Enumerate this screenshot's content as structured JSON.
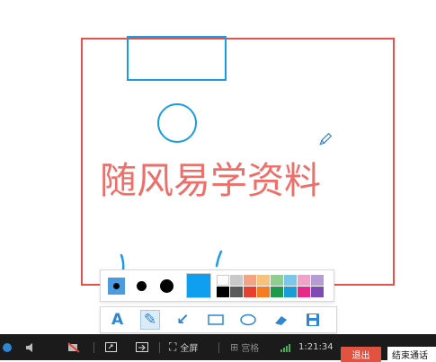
{
  "canvas": {
    "watermark_text": "随风易学资料"
  },
  "colors": {
    "stroke_red": "#e8504a",
    "stroke_blue": "#1a9be8",
    "current_color": "#0f9ff0",
    "toolbar_accent": "#4b9be0",
    "exit_button": "#e25241"
  },
  "toolbar": {
    "sizes": [
      "small-dot",
      "medium-dot",
      "large-dot"
    ],
    "selected_size": "small-dot",
    "palette": [
      "#ffffff",
      "#c9c9c9",
      "#f4a383",
      "#f8c27e",
      "#8fce90",
      "#7bc6ea",
      "#f0a3c8",
      "#b59dd4",
      "#000000",
      "#5a5a5a",
      "#e8402f",
      "#f47c22",
      "#1d9a4a",
      "#1b9bd7",
      "#e7298a",
      "#7e4ab3"
    ],
    "tools": [
      {
        "icon": "text-icon",
        "glyph": "A",
        "active": false
      },
      {
        "icon": "pencil-icon",
        "glyph": "✎",
        "active": true
      },
      {
        "icon": "arrow-icon",
        "glyph": "↙",
        "active": false
      },
      {
        "icon": "rectangle-icon",
        "glyph": "▭",
        "active": false
      },
      {
        "icon": "ellipse-icon",
        "glyph": "◯",
        "active": false
      },
      {
        "icon": "eraser-icon",
        "glyph": "⌫",
        "active": false
      },
      {
        "icon": "save-icon",
        "glyph": "💾",
        "active": false
      }
    ]
  },
  "statusbar": {
    "fullscreen_label": "全屏",
    "layout_label": "宫格",
    "timer": "1:21:34",
    "exit_label": "退出",
    "end_call_label": "结束通话"
  }
}
